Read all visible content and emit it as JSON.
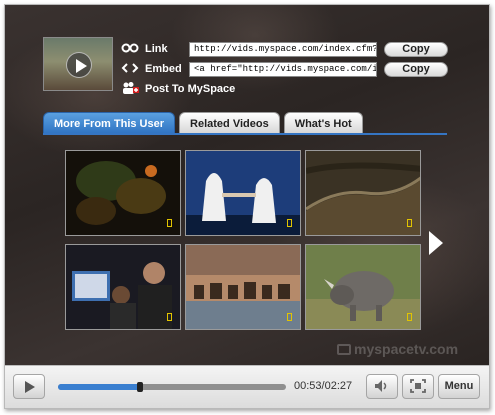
{
  "share": {
    "link_label": "Link",
    "link_value": "http://vids.myspace.com/index.cfm?fu",
    "embed_label": "Embed",
    "embed_value": "<a href=\"http://vids.myspace.com/ind",
    "copy_label": "Copy",
    "post_label": "Post To MySpace",
    "icons": {
      "link": "link-icon",
      "embed": "embed-icon",
      "post": "post-to-myspace-icon"
    }
  },
  "tabs": [
    {
      "label": "More From This User",
      "active": true
    },
    {
      "label": "Related Videos",
      "active": false
    },
    {
      "label": "What's Hot",
      "active": false
    }
  ],
  "videos": [
    {
      "name": "video-thumb-1",
      "thumb": "dark-foliage"
    },
    {
      "name": "video-thumb-2",
      "thumb": "two-figures-in-white"
    },
    {
      "name": "video-thumb-3",
      "thumb": "great-wall"
    },
    {
      "name": "video-thumb-4",
      "thumb": "men-at-computer"
    },
    {
      "name": "video-thumb-5",
      "thumb": "animals-at-waterhole"
    },
    {
      "name": "video-thumb-6",
      "thumb": "rhinoceros"
    }
  ],
  "watermark": "myspacetv.com",
  "player": {
    "time": "00:53/02:27",
    "progress": 0.36,
    "menu_label": "Menu"
  },
  "colors": {
    "accent": "#3575c3",
    "progress": "#3a7fd0"
  }
}
